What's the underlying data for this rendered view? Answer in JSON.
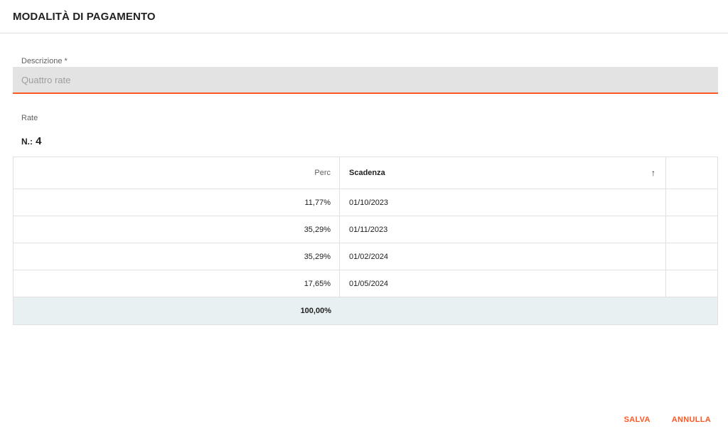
{
  "header": {
    "title": "MODALITÀ DI PAGAMENTO"
  },
  "form": {
    "description_label": "Descrizione *",
    "description_value": "Quattro rate"
  },
  "installments": {
    "section_label": "Rate",
    "count_prefix": "N.:",
    "count_value": "4"
  },
  "table": {
    "columns": {
      "perc": "Perc",
      "scadenza": "Scadenza"
    },
    "sort_icon": "arrow-up-icon",
    "rows": [
      {
        "perc": "11,77%",
        "scadenza": "01/10/2023"
      },
      {
        "perc": "35,29%",
        "scadenza": "01/11/2023"
      },
      {
        "perc": "35,29%",
        "scadenza": "01/02/2024"
      },
      {
        "perc": "17,65%",
        "scadenza": "01/05/2024"
      }
    ],
    "total": "100,00%"
  },
  "buttons": {
    "save": "SALVA",
    "cancel": "ANNULLA"
  },
  "colors": {
    "accent": "#ff5722",
    "input_bg": "#e3e3e3",
    "total_bg": "#e8f0f2"
  }
}
